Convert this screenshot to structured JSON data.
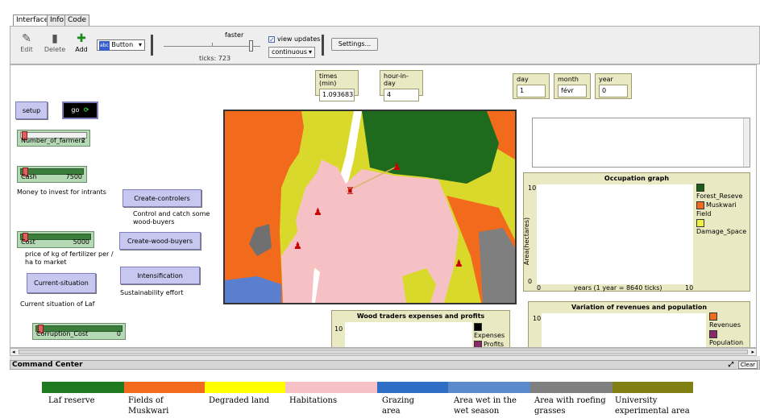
{
  "tabs": [
    "Interface",
    "Info",
    "Code"
  ],
  "toolbar": {
    "edit_label": "Edit",
    "delete_label": "Delete",
    "add_label": "Add",
    "widget_select": "Button",
    "speed_label": "faster",
    "ticks_label": "ticks: 723",
    "view_updates_label": "view updates",
    "view_updates_checked": true,
    "update_mode": "continuous",
    "settings_label": "Settings..."
  },
  "buttons": {
    "setup": "setup",
    "go": "go",
    "create_controlers": "Create-controlers",
    "create_wood_buyers": "Create-wood-buyers",
    "intensification": "Intensification",
    "current_situation": "Current-situation"
  },
  "sliders": {
    "farmers": {
      "label": "Number_of_farmers",
      "value": "2"
    },
    "cash": {
      "label": "Cash",
      "value": "7500"
    },
    "cost": {
      "label": "Cost",
      "value": "5000"
    },
    "corruption": {
      "label": "Corruption_Cost",
      "value": "0"
    }
  },
  "notes": {
    "cash": "Money to invest for intrants",
    "controlers": "Control and catch some wood-buyers",
    "cost": "price of kg of fertilizer per / ha to market",
    "intensification": "Sustainability effort",
    "current": "Current situation of Laf"
  },
  "monitors": {
    "times": {
      "label": "times (min)",
      "value": "1.093683333"
    },
    "hour": {
      "label": "hour-in-day",
      "value": "4"
    },
    "day": {
      "label": "day",
      "value": "1"
    },
    "month": {
      "label": "month",
      "value": "févr"
    },
    "year": {
      "label": "year",
      "value": "0"
    }
  },
  "occupation_plot": {
    "title": "Occupation graph",
    "ylabel": "Area(hectares)",
    "xlabel": "years (1 year = 8640 ticks)",
    "y_max": "10",
    "y_min": "0",
    "x_min": "0",
    "x_max": "10",
    "legend": [
      {
        "name": "Forest_Reseve",
        "color": "#1a5e1a"
      },
      {
        "name": "Muskwari Field",
        "color": "#f26b1d"
      },
      {
        "name": "Damage_Space",
        "color": "#f0f040"
      }
    ]
  },
  "wood_plot": {
    "title": "Wood traders expenses and profits",
    "y_max": "10",
    "legend": [
      {
        "name": "Expenses",
        "color": "#000000"
      },
      {
        "name": "Profits",
        "color": "#8b2a6b"
      }
    ]
  },
  "revenue_plot": {
    "title": "Variation of revenues and population",
    "y_max": "10",
    "legend": [
      {
        "name": "Revenues",
        "color": "#f26b1d"
      },
      {
        "name": "Population",
        "color": "#8b2a6b"
      }
    ]
  },
  "command_center": {
    "title": "Command Center",
    "clear_label": "Clear"
  },
  "land_legend": [
    {
      "label": "Laf reserve",
      "color": "#1f7a1f"
    },
    {
      "label": "Fields of Muskwari",
      "color": "#f26b1d"
    },
    {
      "label": "Degraded land",
      "color": "#ffff00"
    },
    {
      "label": "Habitations",
      "color": "#f5c1c5"
    },
    {
      "label": "Grazing area",
      "color": "#2f6ec5"
    },
    {
      "label": "Area wet in the wet season",
      "color": "#5a8acb"
    },
    {
      "label": "Area with roefing grasses",
      "color": "#7f7f7f"
    },
    {
      "label": "University experimental area",
      "color": "#7f7f14"
    }
  ]
}
